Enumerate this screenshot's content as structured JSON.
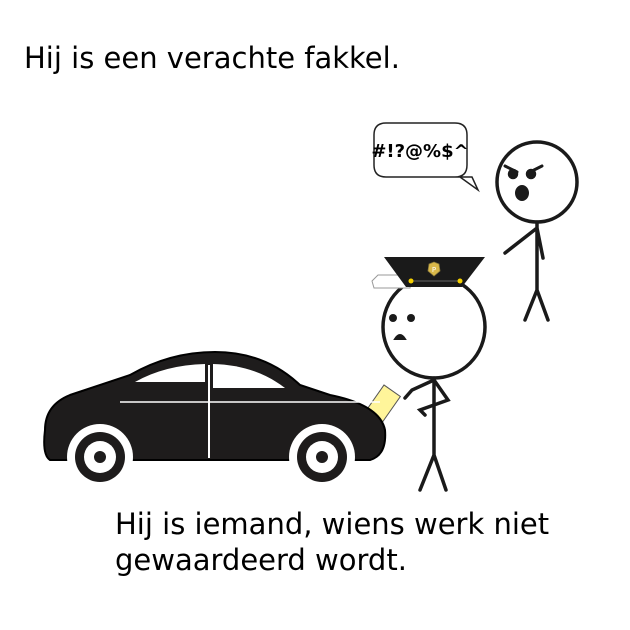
{
  "captions": {
    "top": "Hij is een verachte fakkel.",
    "bottom": "Hij is iemand, wiens werk niet gewaardeerd wordt."
  },
  "speech_bubble": {
    "text": "#!?@%$^"
  },
  "badge": {
    "letter": "P"
  },
  "colors": {
    "ink": "#1a1a1a",
    "hat_accent": "#f5d000",
    "ticket": "#fff59a"
  }
}
